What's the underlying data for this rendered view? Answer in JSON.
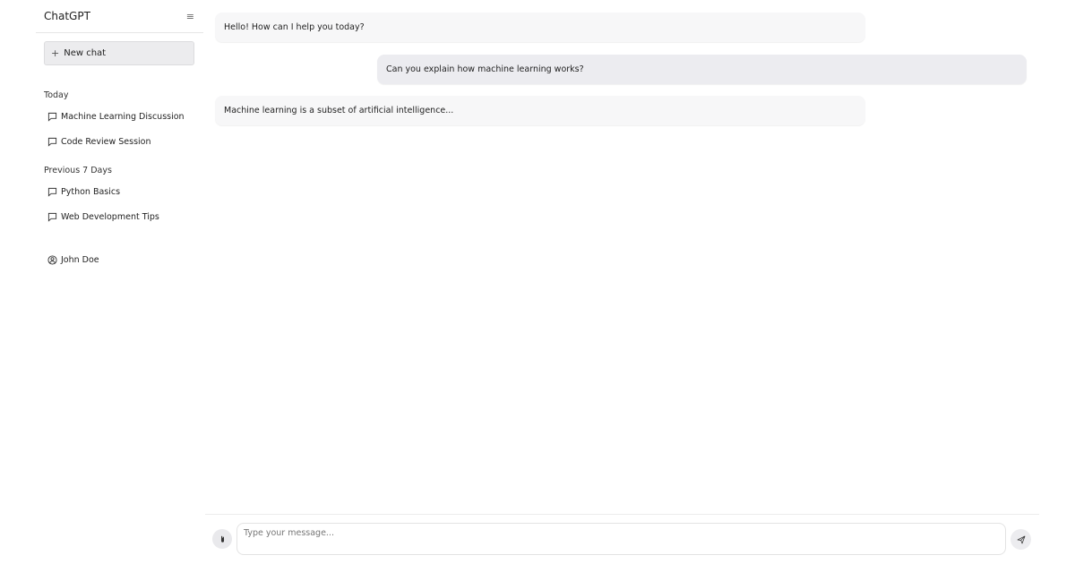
{
  "sidebar": {
    "title": "ChatGPT",
    "menu_icon": "menu-icon",
    "new_chat_label": "New chat",
    "sections": [
      {
        "label": "Today",
        "items": [
          {
            "label": "Machine Learning Discussion",
            "icon": "chat-bubble-icon"
          },
          {
            "label": "Code Review Session",
            "icon": "chat-bubble-icon"
          }
        ]
      },
      {
        "label": "Previous 7 Days",
        "items": [
          {
            "label": "Python Basics",
            "icon": "chat-bubble-icon"
          },
          {
            "label": "Web Development Tips",
            "icon": "chat-bubble-icon"
          }
        ]
      }
    ],
    "user": {
      "name": "John Doe",
      "icon": "user-circle-icon"
    }
  },
  "messages": [
    {
      "role": "assistant",
      "text": "Hello! How can I help you today?"
    },
    {
      "role": "user",
      "text": "Can you explain how machine learning works?"
    },
    {
      "role": "assistant",
      "text": "Machine learning is a subset of artificial intelligence..."
    }
  ],
  "composer": {
    "placeholder": "Type your message...",
    "value": "",
    "attach_icon": "paperclip-icon",
    "send_icon": "send-icon"
  },
  "colors": {
    "assistant_bubble": "#f7f7f8",
    "user_bubble": "#ececf0",
    "new_chat_bg": "#ececee"
  }
}
